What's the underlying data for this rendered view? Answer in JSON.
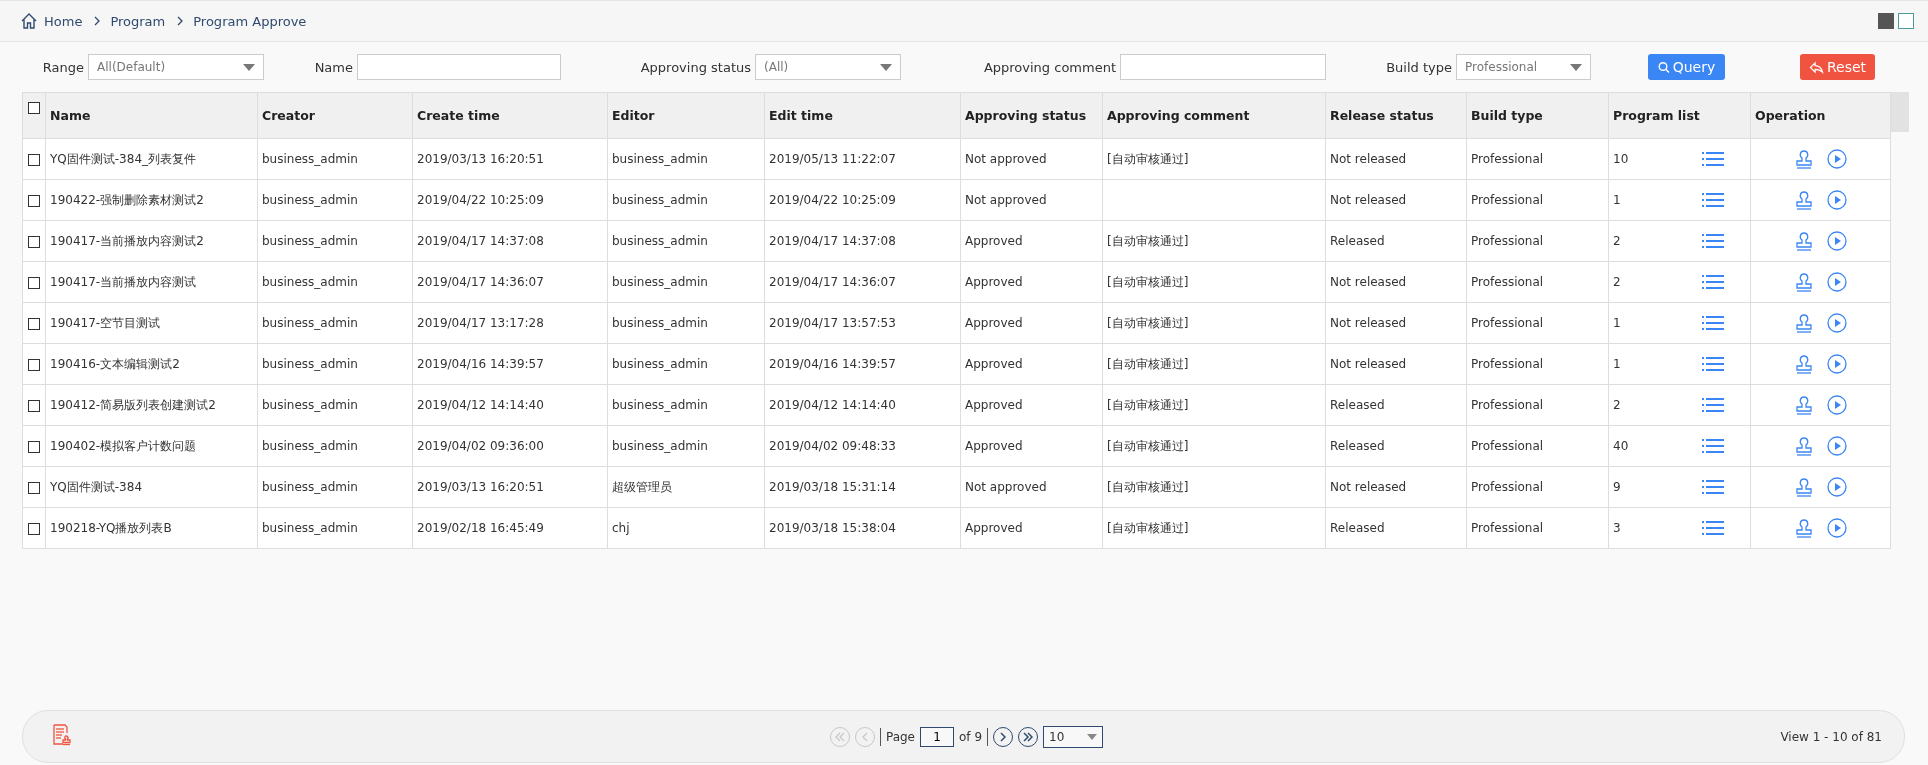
{
  "breadcrumb": {
    "items": [
      "Home",
      "Program",
      "Program Approve"
    ]
  },
  "view_toggle": [
    {
      "selected": true
    },
    {
      "selected": false
    }
  ],
  "filters": {
    "range": {
      "label": "Range",
      "value": "All(Default)"
    },
    "name": {
      "label": "Name"
    },
    "approving_status": {
      "label": "Approving status",
      "value": "(All)"
    },
    "approving_comment": {
      "label": "Approving comment"
    },
    "build_type": {
      "label": "Build type",
      "value": "Professional"
    },
    "buttons": [
      {
        "kind": "query",
        "label": "Query"
      },
      {
        "kind": "reset",
        "label": "Reset"
      }
    ]
  },
  "table": {
    "header_checked": false,
    "columns": [
      "Name",
      "Creator",
      "Create time",
      "Editor",
      "Edit time",
      "Approving status",
      "Approving comment",
      "Release status",
      "Build type",
      "Program list",
      "Operation"
    ],
    "rows": [
      {
        "checked": false,
        "name": "YQ固件测试-384_列表复件",
        "creator": "business_admin",
        "create_time": "2019/03/13 16:20:51",
        "editor": "business_admin",
        "edit_time": "2019/05/13 11:22:07",
        "approving_status": "Not approved",
        "approving_comment": "[自动审核通过]",
        "release_status": "Not released",
        "build_type": "Professional",
        "program_count": "10"
      },
      {
        "checked": false,
        "name": "190422-强制删除素材测试2",
        "creator": "business_admin",
        "create_time": "2019/04/22 10:25:09",
        "editor": "business_admin",
        "edit_time": "2019/04/22 10:25:09",
        "approving_status": "Not approved",
        "release_status": "Not released",
        "build_type": "Professional",
        "program_count": "1"
      },
      {
        "checked": false,
        "name": "190417-当前播放内容测试2",
        "creator": "business_admin",
        "create_time": "2019/04/17 14:37:08",
        "editor": "business_admin",
        "edit_time": "2019/04/17 14:37:08",
        "approving_status": "Approved",
        "approving_comment": "[自动审核通过]",
        "release_status": "Released",
        "build_type": "Professional",
        "program_count": "2"
      },
      {
        "checked": false,
        "name": "190417-当前播放内容测试",
        "creator": "business_admin",
        "create_time": "2019/04/17 14:36:07",
        "editor": "business_admin",
        "edit_time": "2019/04/17 14:36:07",
        "approving_status": "Approved",
        "approving_comment": "[自动审核通过]",
        "release_status": "Not released",
        "build_type": "Professional",
        "program_count": "2"
      },
      {
        "checked": false,
        "name": "190417-空节目测试",
        "creator": "business_admin",
        "create_time": "2019/04/17 13:17:28",
        "editor": "business_admin",
        "edit_time": "2019/04/17 13:57:53",
        "approving_status": "Approved",
        "approving_comment": "[自动审核通过]",
        "release_status": "Not released",
        "build_type": "Professional",
        "program_count": "1"
      },
      {
        "checked": false,
        "name": "190416-文本编辑测试2",
        "creator": "business_admin",
        "create_time": "2019/04/16 14:39:57",
        "editor": "business_admin",
        "edit_time": "2019/04/16 14:39:57",
        "approving_status": "Approved",
        "approving_comment": "[自动审核通过]",
        "release_status": "Not released",
        "build_type": "Professional",
        "program_count": "1"
      },
      {
        "checked": false,
        "name": "190412-简易版列表创建测试2",
        "creator": "business_admin",
        "create_time": "2019/04/12 14:14:40",
        "editor": "business_admin",
        "edit_time": "2019/04/12 14:14:40",
        "approving_status": "Approved",
        "approving_comment": "[自动审核通过]",
        "release_status": "Released",
        "build_type": "Professional",
        "program_count": "2"
      },
      {
        "checked": false,
        "name": "190402-模拟客户计数问题",
        "creator": "business_admin",
        "create_time": "2019/04/02 09:36:00",
        "editor": "business_admin",
        "edit_time": "2019/04/02 09:48:33",
        "approving_status": "Approved",
        "approving_comment": "[自动审核通过]",
        "release_status": "Released",
        "build_type": "Professional",
        "program_count": "40"
      },
      {
        "checked": false,
        "name": "YQ固件测试-384",
        "creator": "business_admin",
        "create_time": "2019/03/13 16:20:51",
        "editor": "超级管理员",
        "edit_time": "2019/03/18 15:31:14",
        "approving_status": "Not approved",
        "approving_comment": "[自动审核通过]",
        "release_status": "Not released",
        "build_type": "Professional",
        "program_count": "9"
      },
      {
        "checked": false,
        "name": "190218-YQ播放列表B",
        "creator": "business_admin",
        "create_time": "2019/02/18 16:45:49",
        "editor": "chj",
        "edit_time": "2019/03/18 15:38:04",
        "approving_status": "Approved",
        "approving_comment": "[自动审核通过]",
        "release_status": "Released",
        "build_type": "Professional",
        "program_count": "3"
      }
    ]
  },
  "pager": {
    "first_disabled": true,
    "prev_disabled": true,
    "next_disabled": false,
    "last_disabled": false,
    "page_label": "Page",
    "page": "1",
    "of_pages": "of 9",
    "page_size": "10",
    "summary": "View 1 - 10 of 81"
  }
}
